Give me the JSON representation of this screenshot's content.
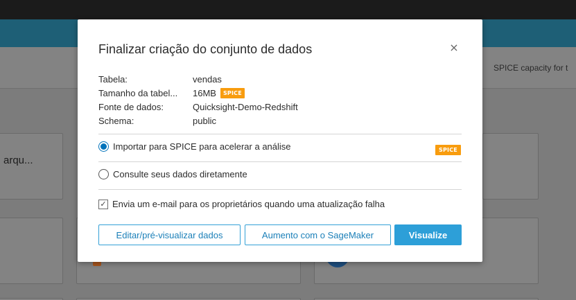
{
  "background": {
    "spice_capacity_label": "SPICE capacity for t",
    "card_label": "arqu..."
  },
  "modal": {
    "title": "Finalizar criação do conjunto de dados",
    "close_icon": "×",
    "info": [
      {
        "key": "Tabela:",
        "value": "vendas"
      },
      {
        "key": "Tamanho da tabel...",
        "value": "16MB",
        "badge": "SPICE"
      },
      {
        "key": "Fonte de dados:",
        "value": "Quicksight-Demo-Redshift"
      },
      {
        "key": "Schema:",
        "value": "public"
      }
    ],
    "options": {
      "import_spice": {
        "label": "Importar para SPICE para acelerar a análise",
        "selected": true,
        "badge": "SPICE"
      },
      "direct_query": {
        "label": "Consulte seus dados diretamente",
        "selected": false
      }
    },
    "email_checkbox": {
      "label": "Envia um e-mail para os proprietários quando uma atualização falha",
      "checked": true,
      "check_glyph": "✓"
    },
    "buttons": {
      "edit_preview": "Editar/pré-visualizar dados",
      "sagemaker": "Aumento com o SageMaker",
      "visualize": "Visualize"
    }
  },
  "colors": {
    "accent": "#0073bb",
    "primary_button": "#2d9fd8",
    "spice_badge": "#f89c0e",
    "header_blue": "#1e5f76"
  },
  "icons": [
    "close-icon",
    "check-icon"
  ]
}
